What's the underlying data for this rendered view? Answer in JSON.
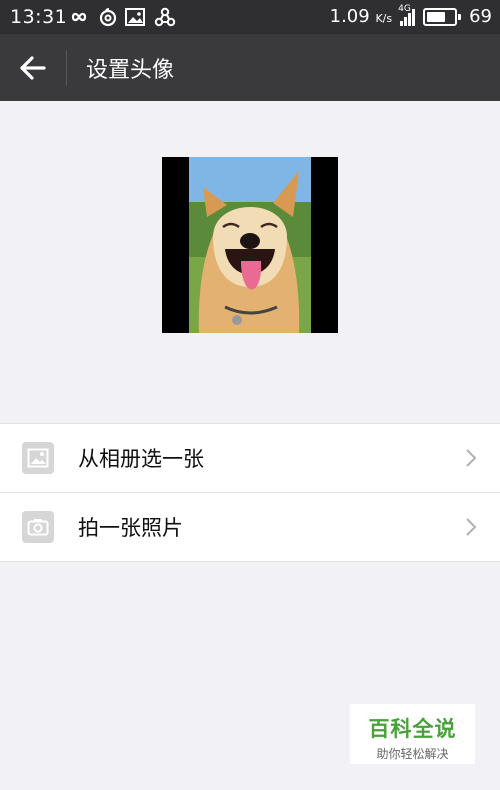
{
  "status_bar": {
    "time": "13:31",
    "speed": "1.09",
    "speed_unit": "K/s",
    "network": "4G",
    "battery": "69",
    "battery_level": 0.69
  },
  "header": {
    "title": "设置头像"
  },
  "options": [
    {
      "label": "从相册选一张",
      "icon": "album-icon"
    },
    {
      "label": "拍一张照片",
      "icon": "camera-icon"
    }
  ],
  "watermark": {
    "title": "百科全说",
    "subtitle": "助你轻松解决"
  },
  "colors": {
    "header_bg": "#3a3a3c",
    "status_bg": "#2f2f31",
    "page_bg": "#f2f1f6",
    "watermark_green": "#48a13b"
  }
}
